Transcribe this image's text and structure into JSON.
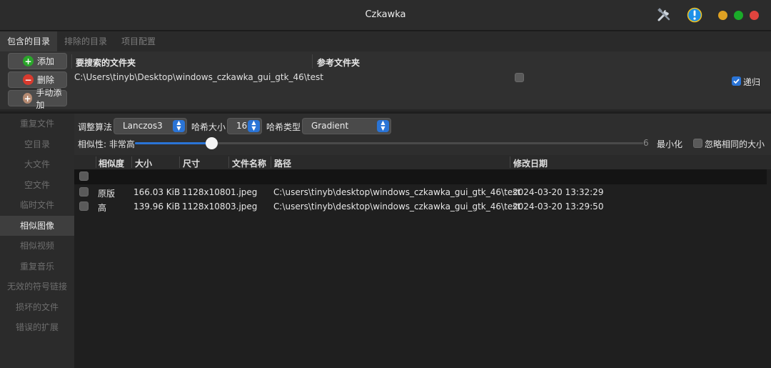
{
  "window": {
    "title": "Czkawka"
  },
  "tabs": [
    {
      "label": "包含的目录",
      "active": true
    },
    {
      "label": "排除的目录",
      "active": false
    },
    {
      "label": "项目配置",
      "active": false
    }
  ],
  "dir_panel": {
    "buttons": {
      "add": "添加",
      "remove": "删除",
      "manual_add": "手动添加"
    },
    "col_search": "要搜索的文件夹",
    "col_reference": "参考文件夹",
    "path": "C:\\Users\\tinyb\\Desktop\\windows_czkawka_gui_gtk_46\\test",
    "reference_checked": false,
    "recursive_label": "递归",
    "recursive_checked": true
  },
  "sidebar": {
    "items": [
      {
        "label": "重复文件",
        "active": false
      },
      {
        "label": "空目录",
        "active": false
      },
      {
        "label": "大文件",
        "active": false
      },
      {
        "label": "空文件",
        "active": false
      },
      {
        "label": "临时文件",
        "active": false
      },
      {
        "label": "相似图像",
        "active": true
      },
      {
        "label": "相似视频",
        "active": false
      },
      {
        "label": "重复音乐",
        "active": false
      },
      {
        "label": "无效的符号链接",
        "active": false
      },
      {
        "label": "损坏的文件",
        "active": false
      },
      {
        "label": "错误的扩展",
        "active": false
      }
    ]
  },
  "controls": {
    "resize_algo_label": "调整算法",
    "resize_algo_value": "Lanczos3",
    "hash_size_label": "哈希大小",
    "hash_size_value": "16",
    "hash_type_label": "哈希类型",
    "hash_type_value": "Gradient",
    "similarity_label": "相似性: 非常高",
    "slider_value": "6",
    "slider_fraction": 0.15,
    "minimize_label": "最小化",
    "ignore_same_size_label": "忽略相同的大小",
    "ignore_same_size_checked": false
  },
  "table": {
    "headers": [
      "相似度",
      "大小",
      "尺寸",
      "文件名称",
      "路径",
      "修改日期"
    ],
    "rows": [
      {
        "similarity": "原版",
        "size": "166.03 KiB",
        "dimensions": "1128x1080",
        "name": "1.jpeg",
        "path": "C:\\users\\tinyb\\desktop\\windows_czkawka_gui_gtk_46\\test",
        "modified": "2024-03-20 13:32:29"
      },
      {
        "similarity": "高",
        "size": "139.96 KiB",
        "dimensions": "1128x1080",
        "name": "3.jpeg",
        "path": "C:\\users\\tinyb\\desktop\\windows_czkawka_gui_gtk_46\\test",
        "modified": "2024-03-20 13:29:50"
      }
    ]
  },
  "colors": {
    "accent": "#2a74d6",
    "close": "#e0443e",
    "minimize": "#dea123",
    "maximize": "#1aab29"
  }
}
